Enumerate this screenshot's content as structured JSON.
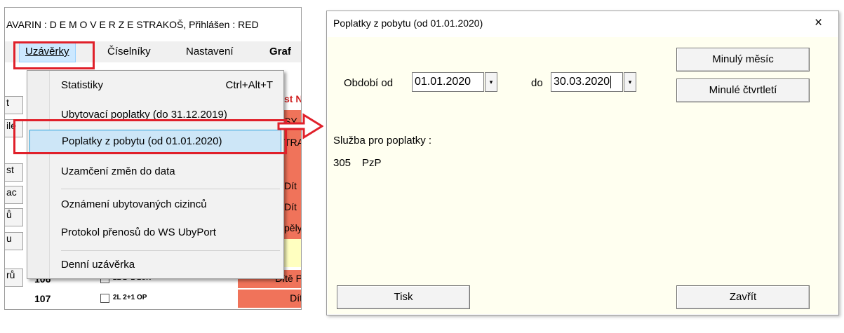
{
  "app": {
    "title_text": "AVARIN : D E M O V E R Z E STRAKOŠ,  Přihlášen :  RED",
    "menubar": {
      "uzaverky": "Uzávěrky",
      "ciselniky": "Číselníky",
      "nastaveni": "Nastavení",
      "graf": "Graf"
    },
    "background": {
      "left_fragments": [
        "t",
        "ile",
        "st",
        "ac",
        "ů",
        "u",
        "rů"
      ],
      "right_fragments": [
        "st N",
        "SY",
        "TRA",
        "Dít",
        "Dít",
        "pěly"
      ],
      "rows": [
        {
          "num": "106",
          "type": "2L 2+2 LUX",
          "status": "Dítě P"
        },
        {
          "num": "107",
          "type": "2L 2+1 OP",
          "status": "Dít"
        }
      ]
    },
    "dropdown": {
      "items": [
        {
          "label": "Statistiky",
          "shortcut": "Ctrl+Alt+T"
        },
        {
          "label": "Ubytovací poplatky (do 31.12.2019)",
          "shortcut": ""
        },
        {
          "label": "Poplatky z pobytu (od 01.01.2020)",
          "shortcut": ""
        },
        {
          "label": "Uzamčení změn do data",
          "shortcut": ""
        },
        {
          "label": "Oznámení ubytovaných cizinců",
          "shortcut": ""
        },
        {
          "label": "Protokol přenosů do WS UbyPort",
          "shortcut": ""
        },
        {
          "label": "Denní uzávěrka",
          "shortcut": ""
        }
      ]
    }
  },
  "dialog": {
    "title": "Poplatky z pobytu (od 01.01.2020)",
    "close_glyph": "×",
    "period_from_label": "Období od",
    "date_from": "01.01.2020",
    "period_to_label": "do",
    "date_to": "30.03.2020",
    "dropdown_glyph": "▾",
    "last_month_button": "Minulý měsíc",
    "last_quarter_button": "Minulé čtvrtletí",
    "service_label": "Služba pro poplatky :",
    "service_code": "305",
    "service_name": "PzP",
    "print_button": "Tisk",
    "close_button": "Zavřít"
  },
  "colors": {
    "highlight_red": "#e0202a",
    "dialog_body_bg": "#fffff0",
    "menu_selected_bg": "#cde6f7",
    "status_red": "#f0735a"
  }
}
